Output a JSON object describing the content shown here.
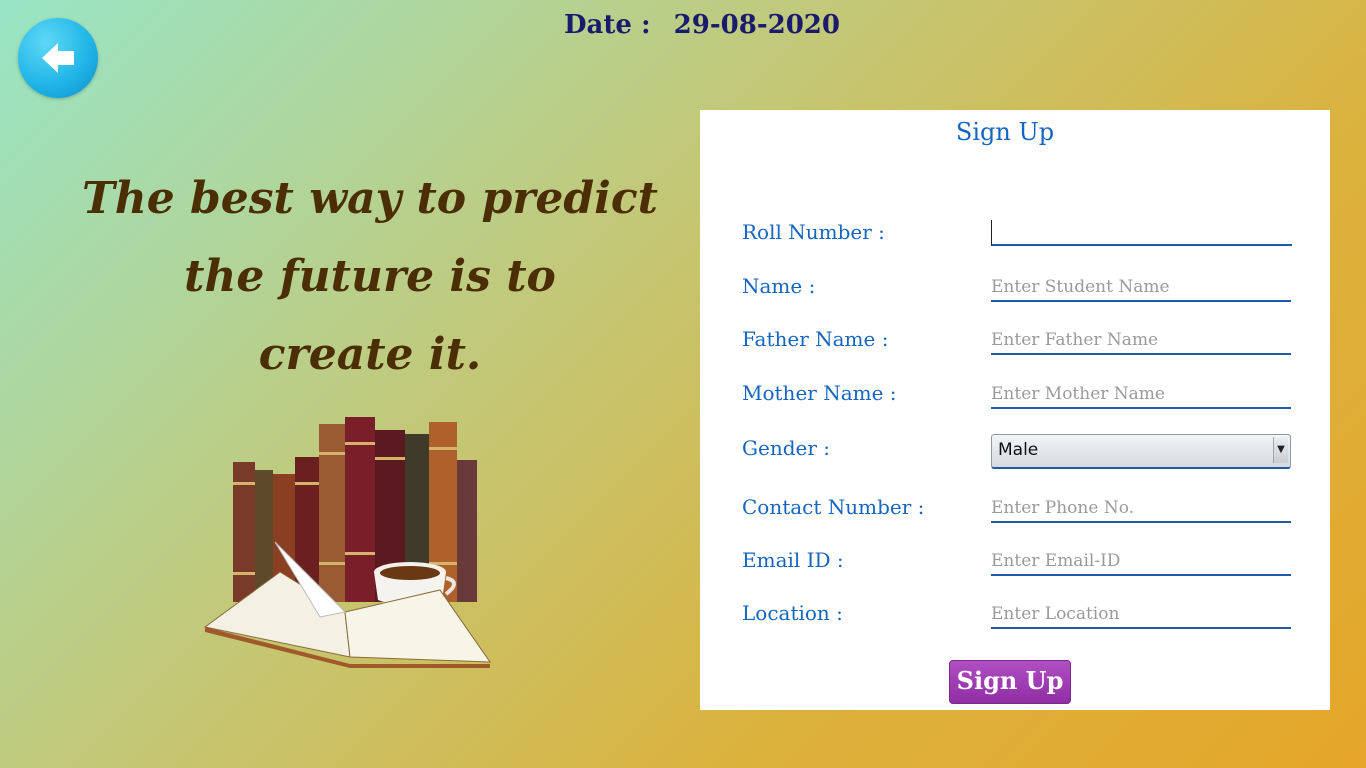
{
  "header": {
    "date_label": "Date :",
    "date_value": "29-08-2020"
  },
  "back_button": {
    "icon": "arrow-left-icon",
    "color": "#22b6e8"
  },
  "quote": {
    "line1": "The best way to predict",
    "line2": "the future is to",
    "line3": "create it."
  },
  "illustration": {
    "icon": "books-and-coffee-image"
  },
  "form": {
    "title": "Sign Up",
    "fields": [
      {
        "label": "Roll Number :",
        "placeholder": "",
        "value": ""
      },
      {
        "label": "Name :",
        "placeholder": "Enter Student Name",
        "value": ""
      },
      {
        "label": "Father Name :",
        "placeholder": "Enter Father Name",
        "value": ""
      },
      {
        "label": "Mother Name :",
        "placeholder": "Enter Mother Name",
        "value": ""
      },
      {
        "label": "Gender :",
        "selected": "Male"
      },
      {
        "label": "Contact Number :",
        "placeholder": "Enter Phone No.",
        "value": ""
      },
      {
        "label": "Email ID :",
        "placeholder": "Enter Email-ID",
        "value": ""
      },
      {
        "label": "Location :",
        "placeholder": "Enter Location",
        "value": ""
      }
    ],
    "submit_label": "Sign Up",
    "accent_color": "#1565c0",
    "button_color": "#a23fb6"
  }
}
